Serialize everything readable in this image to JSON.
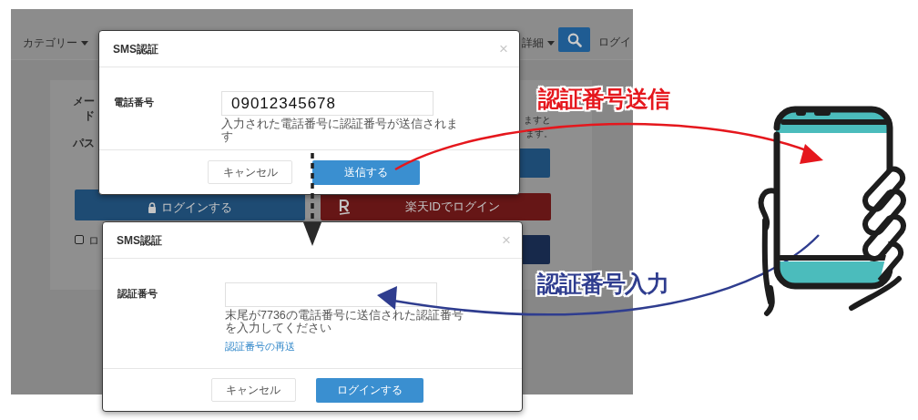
{
  "background_page": {
    "category_menu": "カテゴリー",
    "detail_menu": "詳細",
    "login_link": "ログイ",
    "form_labels": [
      "メー",
      "ド",
      "パス"
    ],
    "note_lines": [
      "ますと",
      "ます。"
    ],
    "login_button": "ログインする",
    "rakuten_button": "楽天IDでログイン",
    "remember_checkbox": {
      "label": "ロ",
      "checked": false
    }
  },
  "dialogs": [
    {
      "title": "SMS認証",
      "close": "×",
      "field_label": "電話番号",
      "value": "09012345678",
      "help": "入力された電話番号に認証番号が送信されます",
      "buttons": [
        {
          "label": "キャンセル",
          "kind": "secondary"
        },
        {
          "label": "送信する",
          "kind": "primary"
        }
      ]
    },
    {
      "title": "SMS認証",
      "close": "×",
      "field_label": "認証番号",
      "help": "末尾が7736の電話番号に送信された認証番号を入力してください",
      "link": "認証番号の再送",
      "buttons": [
        {
          "label": "キャンセル",
          "kind": "secondary"
        },
        {
          "label": "ログインする",
          "kind": "primary"
        }
      ]
    }
  ],
  "annotations": [
    {
      "text": "認証番号送信",
      "color": "#e5171d"
    },
    {
      "text": "認証番号入力",
      "color": "#2f3d8f"
    }
  ]
}
